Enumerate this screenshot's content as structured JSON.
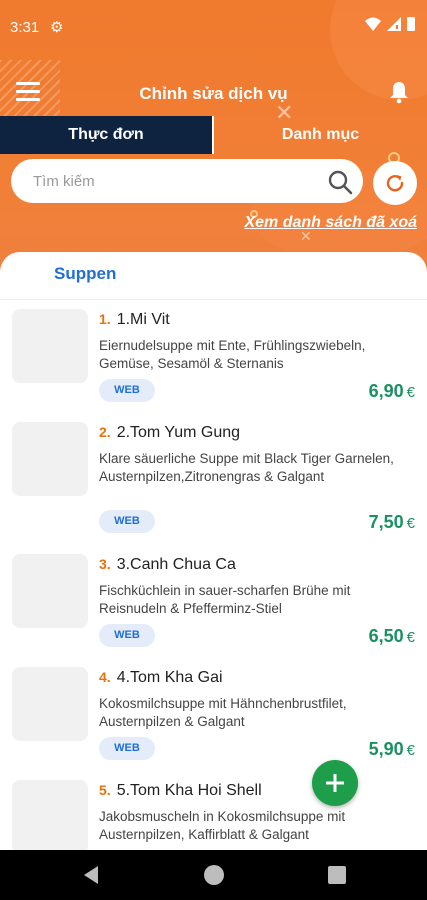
{
  "status_bar": {
    "time": "3:31"
  },
  "app_bar": {
    "title": "Chỉnh sửa dịch vụ"
  },
  "tabs": [
    {
      "label": "Thực đơn",
      "active": true
    },
    {
      "label": "Danh mục",
      "active": false
    }
  ],
  "search": {
    "placeholder": "Tìm kiếm",
    "value": ""
  },
  "deleted_link": "Xem danh sách đã xoá",
  "category": "Suppen",
  "items": [
    {
      "num": "1.",
      "name": "1.Mi Vit",
      "desc": "Eiernudelsuppe mit Ente, Frühlingszwiebeln, Gemüse, Sesamöl & Sternanis",
      "badge": "WEB",
      "price": "6,90",
      "currency": "€"
    },
    {
      "num": "2.",
      "name": "2.Tom Yum Gung",
      "desc": "Klare säuerliche Suppe mit Black Tiger Garnelen, Austernpilzen,Zitronengras & Galgant",
      "badge": "WEB",
      "price": "7,50",
      "currency": "€"
    },
    {
      "num": "3.",
      "name": "3.Canh Chua Ca",
      "desc": "Fischküchlein in sauer-scharfen Brühe mit Reisnudeln & Pfefferminz-Stiel",
      "badge": "WEB",
      "price": "6,50",
      "currency": "€"
    },
    {
      "num": "4.",
      "name": "4.Tom Kha Gai",
      "desc": "Kokosmilchsuppe mit Hähnchenbrustfilet, Austernpilzen & Galgant",
      "badge": "WEB",
      "price": "5,90",
      "currency": "€"
    },
    {
      "num": "5.",
      "name": "5.Tom Kha Hoi Shell",
      "desc": "Jakobsmuscheln in Kokosmilchsuppe mit Austernpilzen, Kaffirblatt & Galgant",
      "badge": "",
      "price": "",
      "currency": ""
    }
  ],
  "colors": {
    "header": "#f07a2e",
    "tab_active": "#0d2340",
    "price": "#1a9160",
    "link_blue": "#1f6fd6",
    "fab": "#1e9e4a"
  }
}
